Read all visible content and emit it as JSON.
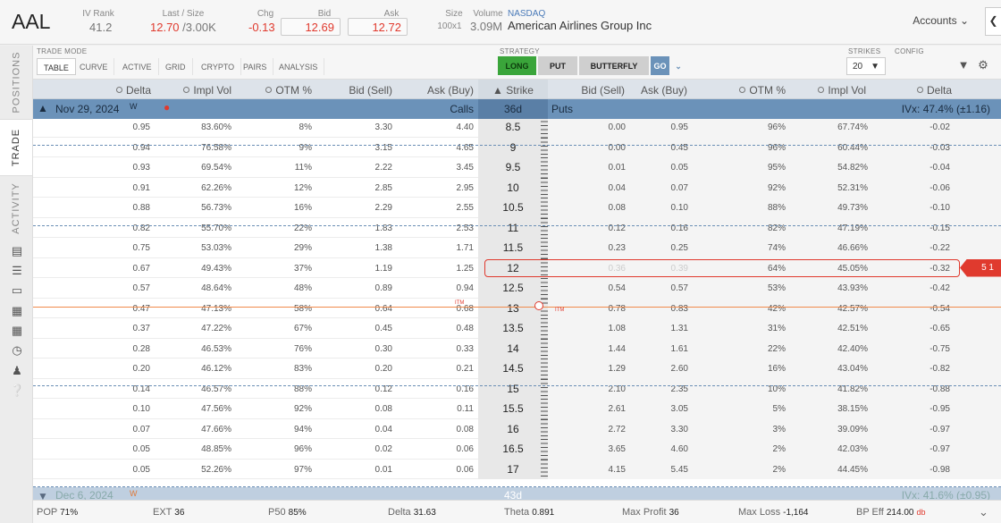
{
  "header": {
    "symbol": "AAL",
    "iv_rank_label": "IV Rank",
    "iv_rank": "41.2",
    "last_size_label": "Last / Size",
    "last": "12.70",
    "size_slash": "/3.00K",
    "chg_label": "Chg",
    "chg": "-0.13",
    "bid_label": "Bid (Sell)",
    "bid": "12.69",
    "ask_label": "Ask (Buy)",
    "ask": "12.72",
    "size_label": "Size",
    "size": "100x1",
    "volume_label": "Volume",
    "volume": "3.09M",
    "exchange": "NASDAQ",
    "name": "American Airlines Group Inc",
    "accounts": "Accounts"
  },
  "side": {
    "tabs": [
      "POSITIONS",
      "TRADE",
      "ACTIVITY"
    ]
  },
  "toolbar": {
    "trade_mode_label": "TRADE MODE",
    "modes": [
      "TABLE",
      "CURVE",
      "ACTIVE",
      "GRID",
      "CRYPTO",
      "PAIRS",
      "ANALYSIS"
    ],
    "strategy_label": "STRATEGY",
    "long": "LONG",
    "put": "PUT",
    "butterfly": "BUTTERFLY",
    "go": "GO",
    "strikes_label": "STRIKES",
    "strikes_value": "20",
    "config_label": "CONFIG"
  },
  "columns": {
    "call": [
      "Delta",
      "Impl Vol",
      "OTM %",
      "Bid (Sell)",
      "Ask (Buy)"
    ],
    "strike": "Strike",
    "put": [
      "Bid (Sell)",
      "Ask (Buy)",
      "OTM %",
      "Impl Vol",
      "Delta"
    ]
  },
  "expiry1": {
    "date": "Nov 29, 2024",
    "tag": "W",
    "calls": "Calls",
    "dte": "36d",
    "puts": "Puts",
    "ivx": "IVx: 47.4% (±1.16)"
  },
  "expiry2": {
    "date": "Dec 6, 2024",
    "tag": "W",
    "dte": "43d",
    "ivx": "IVx: 41.6% (±0.95)"
  },
  "rows": [
    {
      "cd": "0.95",
      "civ": "83.60%",
      "cotm": "8%",
      "cb": "3.30",
      "ca": "4.40",
      "k": "8.5",
      "pb": "0.00",
      "pa": "0.95",
      "potm": "96%",
      "piv": "67.74%",
      "pd": "-0.02"
    },
    {
      "cd": "0.94",
      "civ": "76.58%",
      "cotm": "9%",
      "cb": "3.15",
      "ca": "4.65",
      "k": "9",
      "pb": "0.00",
      "pa": "0.45",
      "potm": "96%",
      "piv": "60.44%",
      "pd": "-0.03"
    },
    {
      "cd": "0.93",
      "civ": "69.54%",
      "cotm": "11%",
      "cb": "2.22",
      "ca": "3.45",
      "k": "9.5",
      "pb": "0.01",
      "pa": "0.05",
      "potm": "95%",
      "piv": "54.82%",
      "pd": "-0.04"
    },
    {
      "cd": "0.91",
      "civ": "62.26%",
      "cotm": "12%",
      "cb": "2.85",
      "ca": "2.95",
      "k": "10",
      "pb": "0.04",
      "pa": "0.07",
      "potm": "92%",
      "piv": "52.31%",
      "pd": "-0.06"
    },
    {
      "cd": "0.88",
      "civ": "56.73%",
      "cotm": "16%",
      "cb": "2.29",
      "ca": "2.55",
      "k": "10.5",
      "pb": "0.08",
      "pa": "0.10",
      "potm": "88%",
      "piv": "49.73%",
      "pd": "-0.10"
    },
    {
      "cd": "0.82",
      "civ": "55.70%",
      "cotm": "22%",
      "cb": "1.83",
      "ca": "2.53",
      "k": "11",
      "pb": "0.12",
      "pa": "0.16",
      "potm": "82%",
      "piv": "47.19%",
      "pd": "-0.15"
    },
    {
      "cd": "0.75",
      "civ": "53.03%",
      "cotm": "29%",
      "cb": "1.38",
      "ca": "1.71",
      "k": "11.5",
      "pb": "0.23",
      "pa": "0.25",
      "potm": "74%",
      "piv": "46.66%",
      "pd": "-0.22"
    },
    {
      "cd": "0.67",
      "civ": "49.43%",
      "cotm": "37%",
      "cb": "1.19",
      "ca": "1.25",
      "k": "12",
      "pb": "0.36",
      "pa": "0.39",
      "potm": "64%",
      "piv": "45.05%",
      "pd": "-0.32",
      "sel": true,
      "qty": "5 1"
    },
    {
      "cd": "0.57",
      "civ": "48.64%",
      "cotm": "48%",
      "cb": "0.89",
      "ca": "0.94",
      "k": "12.5",
      "pb": "0.54",
      "pa": "0.57",
      "potm": "53%",
      "piv": "43.93%",
      "pd": "-0.42"
    },
    {
      "cd": "0.47",
      "civ": "47.13%",
      "cotm": "58%",
      "cb": "0.64",
      "ca": "0.68",
      "k": "13",
      "pb": "0.78",
      "pa": "0.83",
      "potm": "42%",
      "piv": "42.57%",
      "pd": "-0.54"
    },
    {
      "cd": "0.37",
      "civ": "47.22%",
      "cotm": "67%",
      "cb": "0.45",
      "ca": "0.48",
      "k": "13.5",
      "pb": "1.08",
      "pa": "1.31",
      "potm": "31%",
      "piv": "42.51%",
      "pd": "-0.65"
    },
    {
      "cd": "0.28",
      "civ": "46.53%",
      "cotm": "76%",
      "cb": "0.30",
      "ca": "0.33",
      "k": "14",
      "pb": "1.44",
      "pa": "1.61",
      "potm": "22%",
      "piv": "42.40%",
      "pd": "-0.75"
    },
    {
      "cd": "0.20",
      "civ": "46.12%",
      "cotm": "83%",
      "cb": "0.20",
      "ca": "0.21",
      "k": "14.5",
      "pb": "1.29",
      "pa": "2.60",
      "potm": "16%",
      "piv": "43.04%",
      "pd": "-0.82"
    },
    {
      "cd": "0.14",
      "civ": "46.57%",
      "cotm": "88%",
      "cb": "0.12",
      "ca": "0.16",
      "k": "15",
      "pb": "2.10",
      "pa": "2.35",
      "potm": "10%",
      "piv": "41.82%",
      "pd": "-0.88"
    },
    {
      "cd": "0.10",
      "civ": "47.56%",
      "cotm": "92%",
      "cb": "0.08",
      "ca": "0.11",
      "k": "15.5",
      "pb": "2.61",
      "pa": "3.05",
      "potm": "5%",
      "piv": "38.15%",
      "pd": "-0.95"
    },
    {
      "cd": "0.07",
      "civ": "47.66%",
      "cotm": "94%",
      "cb": "0.04",
      "ca": "0.08",
      "k": "16",
      "pb": "2.72",
      "pa": "3.30",
      "potm": "3%",
      "piv": "39.09%",
      "pd": "-0.97"
    },
    {
      "cd": "0.05",
      "civ": "48.85%",
      "cotm": "96%",
      "cb": "0.02",
      "ca": "0.06",
      "k": "16.5",
      "pb": "3.65",
      "pa": "4.60",
      "potm": "2%",
      "piv": "42.03%",
      "pd": "-0.97"
    },
    {
      "cd": "0.05",
      "civ": "52.26%",
      "cotm": "97%",
      "cb": "0.01",
      "ca": "0.06",
      "k": "17",
      "pb": "4.15",
      "pa": "5.45",
      "potm": "2%",
      "piv": "44.45%",
      "pd": "-0.98"
    }
  ],
  "itm_label": "ITM",
  "footer": {
    "pop_label": "POP",
    "pop": "71%",
    "ext_label": "EXT",
    "ext": "36",
    "p50_label": "P50",
    "p50": "85%",
    "delta_label": "Delta",
    "delta": "31.63",
    "theta_label": "Theta",
    "theta": "0.891",
    "maxprofit_label": "Max Profit",
    "maxprofit": "36",
    "maxloss_label": "Max Loss",
    "maxloss": "-1,164",
    "bpeff_label": "BP Eff",
    "bpeff": "214.00",
    "bpeff_unit": "db"
  },
  "colors": {
    "accent": "#6b92b9",
    "selected_border": "#e03a2e",
    "long_green": "#3aa53a",
    "itm_line": "#f08a4b"
  }
}
